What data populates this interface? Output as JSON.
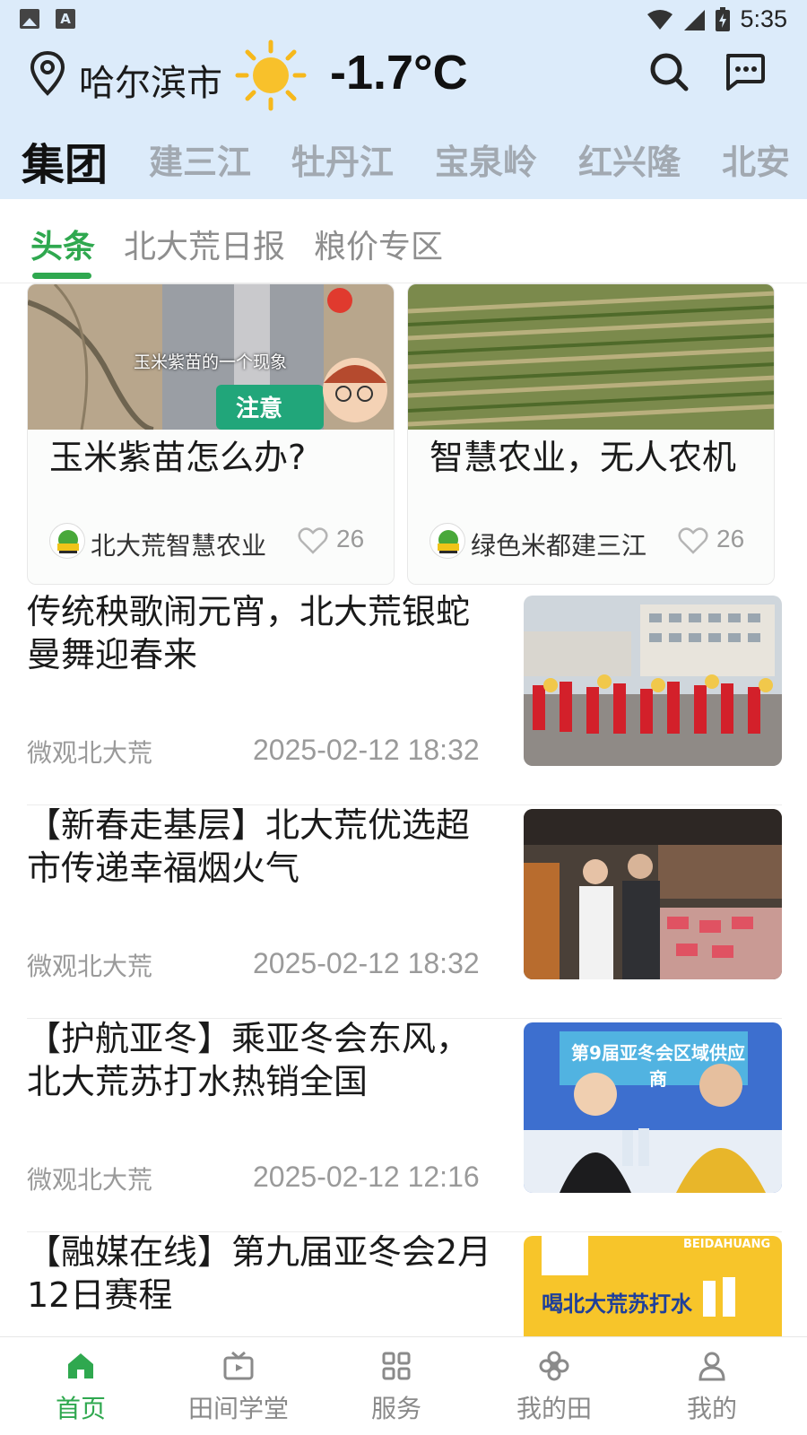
{
  "status_bar": {
    "time": "5:35"
  },
  "header": {
    "city": "哈尔滨市",
    "weather_icon": "sun-icon",
    "temperature": "-1.7°C"
  },
  "region_tabs": [
    "集团",
    "建三江",
    "牡丹江",
    "宝泉岭",
    "红兴隆",
    "北安"
  ],
  "sub_tabs": [
    "头条",
    "北大荒日报",
    "粮价专区"
  ],
  "cards": [
    {
      "title": "玉米紫苗怎么办?",
      "image_caption": "玉米紫苗的一个现象",
      "image_badge": "注意",
      "author": "北大荒智慧农业",
      "likes": "26"
    },
    {
      "title": "智慧农业，无人农机",
      "author": "绿色米都建三江",
      "likes": "26"
    }
  ],
  "articles": [
    {
      "title": "传统秧歌闹元宵，北大荒银蛇曼舞迎春来",
      "source": "微观北大荒",
      "time": "2025-02-12 18:32"
    },
    {
      "title": "【新春走基层】北大荒优选超市传递幸福烟火气",
      "source": "微观北大荒",
      "time": "2025-02-12 18:32"
    },
    {
      "title": "【护航亚冬】乘亚冬会东风，北大荒苏打水热销全国",
      "source": "微观北大荒",
      "time": "2025-02-12 12:16",
      "image_text": "第9届亚冬会区域供应商"
    },
    {
      "title": "【融媒在线】第九届亚冬会2月12日赛程",
      "source": "",
      "time": "",
      "image_text": "喝北大荒苏打水",
      "image_subtext": "BEIDAHUANG"
    }
  ],
  "bottom_nav": [
    "首页",
    "田间学堂",
    "服务",
    "我的田",
    "我的"
  ],
  "colors": {
    "accent": "#2fa84f",
    "header_bg": "#dcebfa"
  }
}
